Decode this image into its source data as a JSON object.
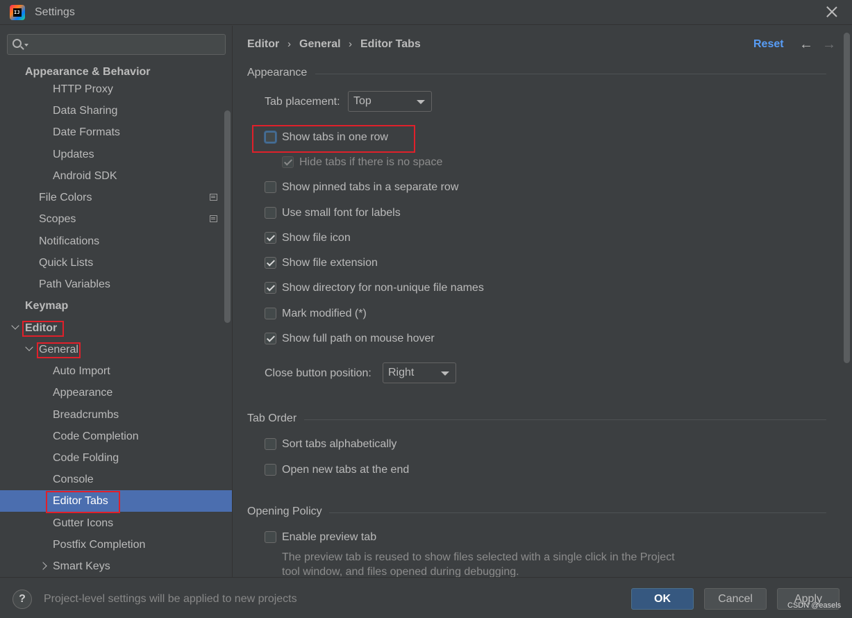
{
  "window": {
    "title": "Settings",
    "logo_text": "IJ"
  },
  "search": {
    "placeholder": ""
  },
  "tree": {
    "items": [
      {
        "label": "Appearance & Behavior"
      },
      {
        "label": "HTTP Proxy"
      },
      {
        "label": "Data Sharing"
      },
      {
        "label": "Date Formats"
      },
      {
        "label": "Updates"
      },
      {
        "label": "Android SDK"
      },
      {
        "label": "File Colors"
      },
      {
        "label": "Scopes"
      },
      {
        "label": "Notifications"
      },
      {
        "label": "Quick Lists"
      },
      {
        "label": "Path Variables"
      },
      {
        "label": "Keymap"
      },
      {
        "label": "Editor"
      },
      {
        "label": "General"
      },
      {
        "label": "Auto Import"
      },
      {
        "label": "Appearance"
      },
      {
        "label": "Breadcrumbs"
      },
      {
        "label": "Code Completion"
      },
      {
        "label": "Code Folding"
      },
      {
        "label": "Console"
      },
      {
        "label": "Editor Tabs"
      },
      {
        "label": "Gutter Icons"
      },
      {
        "label": "Postfix Completion"
      },
      {
        "label": "Smart Keys"
      }
    ]
  },
  "header": {
    "breadcrumb": [
      "Editor",
      "General",
      "Editor Tabs"
    ],
    "separator": "›",
    "reset": "Reset",
    "back_icon": "←",
    "forward_icon": "→"
  },
  "appearance": {
    "title": "Appearance",
    "tab_placement_label": "Tab placement:",
    "tab_placement_value": "Top",
    "options": [
      {
        "label": "Show tabs in one row",
        "checked": false
      },
      {
        "label": "Hide tabs if there is no space",
        "checked": true,
        "disabled": true
      },
      {
        "label": "Show pinned tabs in a separate row",
        "checked": false
      },
      {
        "label": "Use small font for labels",
        "checked": false
      },
      {
        "label": "Show file icon",
        "checked": true
      },
      {
        "label": "Show file extension",
        "checked": true
      },
      {
        "label": "Show directory for non-unique file names",
        "checked": true
      },
      {
        "label": "Mark modified (*)",
        "checked": false
      },
      {
        "label": "Show full path on mouse hover",
        "checked": true
      }
    ],
    "close_button_label": "Close button position:",
    "close_button_value": "Right"
  },
  "tab_order": {
    "title": "Tab Order",
    "options": [
      {
        "label": "Sort tabs alphabetically",
        "checked": false
      },
      {
        "label": "Open new tabs at the end",
        "checked": false
      }
    ]
  },
  "opening_policy": {
    "title": "Opening Policy",
    "options": [
      {
        "label": "Enable preview tab",
        "checked": false
      }
    ],
    "note_line1": "The preview tab is reused to show files selected with a single click in the Project",
    "note_line2": "tool window, and files opened during debugging."
  },
  "footer": {
    "help_icon": "?",
    "text": "Project-level settings will be applied to new projects",
    "ok": "OK",
    "cancel": "Cancel",
    "apply": "Apply",
    "watermark": "CSDN @easels"
  },
  "colors": {
    "accent": "#4b6eaf",
    "link": "#589df6",
    "highlight": "#e0202a"
  }
}
